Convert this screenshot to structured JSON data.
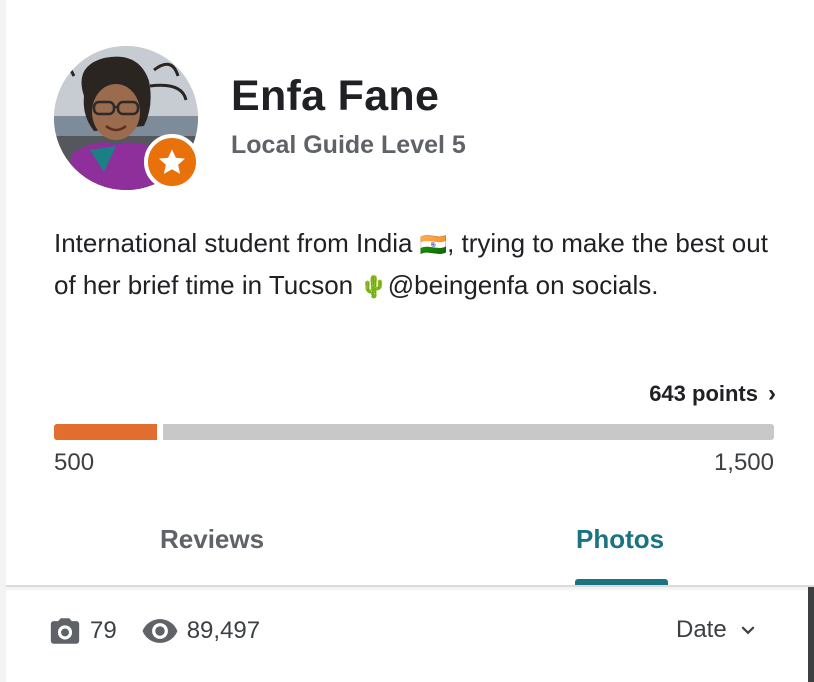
{
  "profile": {
    "name": "Enfa Fane",
    "level": "Local Guide Level 5",
    "bio_part1": "International student from India ",
    "bio_flag": "🇮🇳",
    "bio_part2": ", trying to make the best out of her brief time in Tucson ",
    "bio_cactus": "🌵",
    "bio_part3": "@beingenfa on socials."
  },
  "points": {
    "label": "643 points",
    "chevron": "›",
    "value": 643,
    "range_min": 500,
    "range_max": 1500,
    "min_label": "500",
    "max_label": "1,500"
  },
  "tabs": [
    {
      "label": "Reviews",
      "active": false
    },
    {
      "label": "Photos",
      "active": true
    }
  ],
  "stats": {
    "photo_count": "79",
    "photo_icon": "camera-icon",
    "view_count": "89,497",
    "view_icon": "eye-icon"
  },
  "sort": {
    "label": "Date",
    "icon": "chevron-down-icon"
  },
  "colors": {
    "badge": "#e8710a",
    "progress_fill": "#e16e2f",
    "progress_track": "#c8c8c8",
    "active_tab": "#1a7380",
    "inactive_tab": "#5f6368"
  }
}
